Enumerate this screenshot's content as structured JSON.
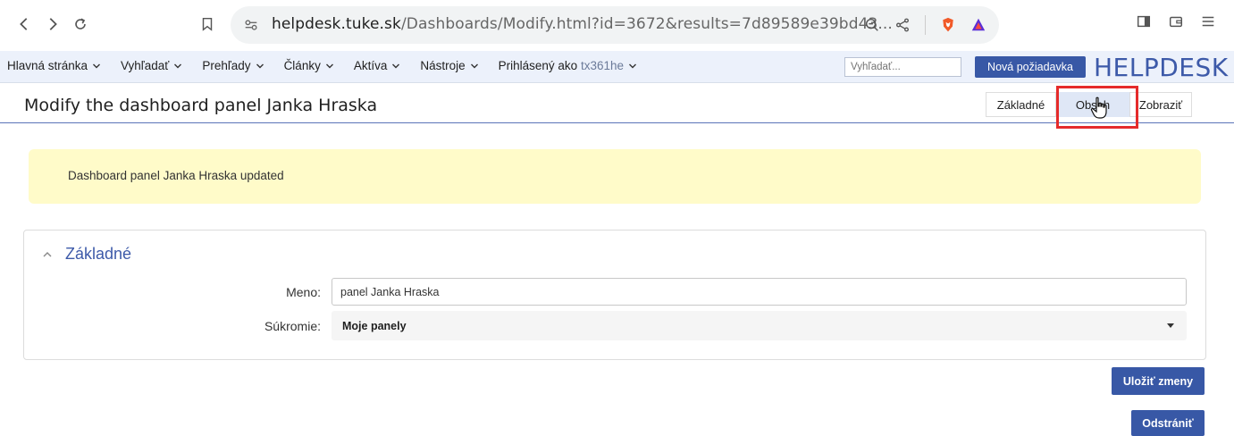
{
  "browser": {
    "url_host": "helpdesk.tuke.sk",
    "url_path": "/Dashboards/Modify.html?id=3672&results=7d89589e39bd43..."
  },
  "menu": {
    "items": [
      {
        "label": "Hlavná stránka"
      },
      {
        "label": "Vyhľadať"
      },
      {
        "label": "Prehľady"
      },
      {
        "label": "Články"
      },
      {
        "label": "Aktíva"
      },
      {
        "label": "Nástroje"
      }
    ],
    "user_prefix": "Prihlásený ako",
    "user_name": "tx361he",
    "search_placeholder": "Vyhľadať...",
    "new_ticket_label": "Nová požiadavka",
    "logo_text": "HELPDESK"
  },
  "page": {
    "title": "Modify the dashboard panel Janka Hraska",
    "tabs": [
      {
        "label": "Základné"
      },
      {
        "label": "Obsah"
      },
      {
        "label": "Zobraziť"
      }
    ]
  },
  "notice": {
    "text": "Dashboard panel Janka Hraska updated"
  },
  "section": {
    "title": "Základné",
    "name_label": "Meno:",
    "name_value": "panel Janka Hraska",
    "privacy_label": "Súkromie:",
    "privacy_value": "Moje panely"
  },
  "actions": {
    "save_label": "Uložiť zmeny",
    "delete_label": "Odstrániť"
  },
  "colors": {
    "accent": "#3858a6",
    "menubar_bg": "#ecf1fb",
    "notice_bg": "#fffbc9",
    "highlight": "#e52b2b",
    "active_tab_bg": "#dfe7f6"
  }
}
